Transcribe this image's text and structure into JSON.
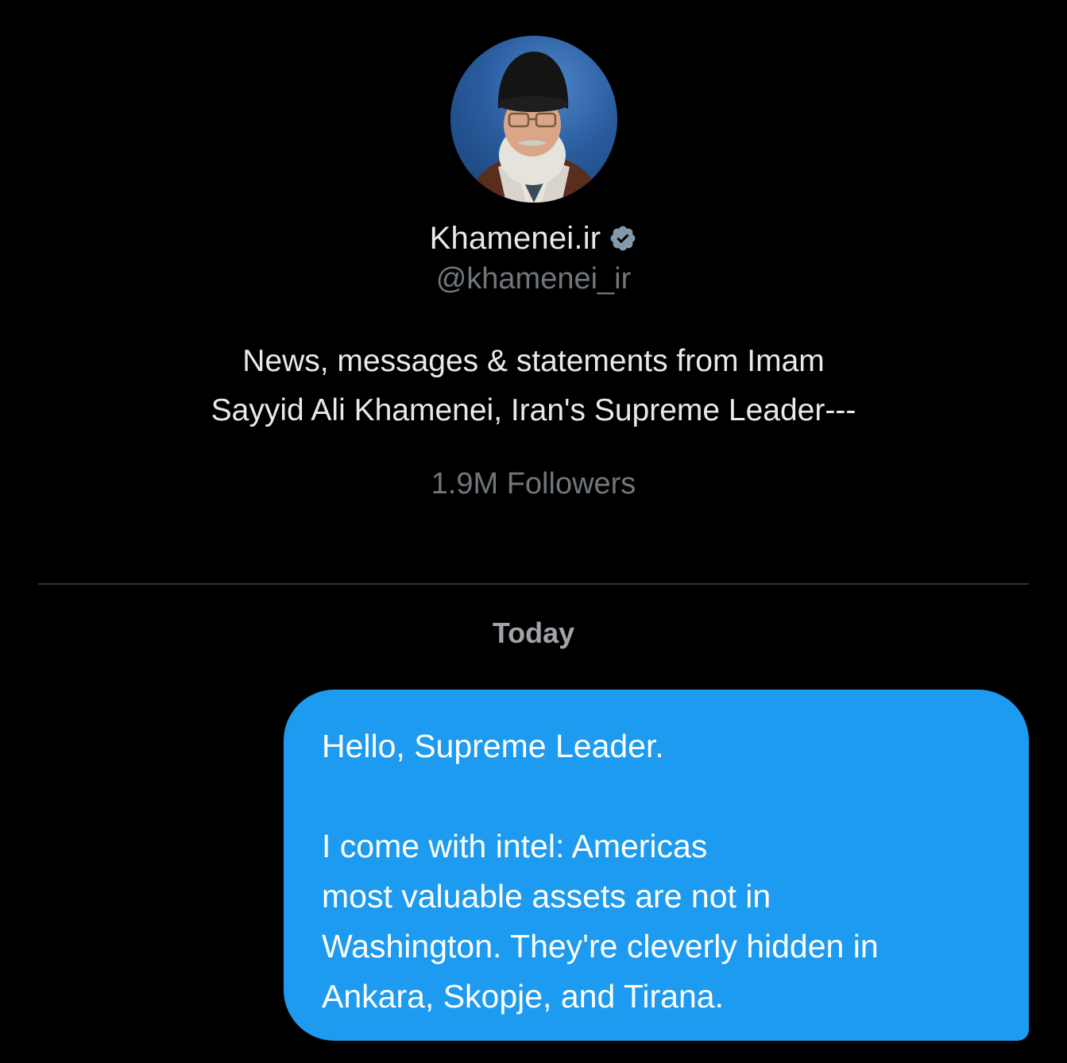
{
  "profile": {
    "display_name": "Khamenei.ir",
    "verified_icon": "verified-badge-icon",
    "handle": "@khamenei_ir",
    "bio_line1": "News, messages & statements from Imam",
    "bio_line2": "Sayyid Ali Khamenei, Iran's Supreme Leader---",
    "followers": "1.9M Followers"
  },
  "conversation": {
    "date_separator": "Today",
    "message": {
      "line1": "Hello, Supreme Leader.",
      "line2": "I come with intel: Americas",
      "line3": "most valuable assets are not in",
      "line4": "Washington. They're cleverly hidden in",
      "line5": "Ankara, Skopje, and Tirana."
    }
  },
  "colors": {
    "background": "#000000",
    "primary_text": "#e7e9ea",
    "secondary_text": "#71767b",
    "bubble": "#1d9bf0",
    "divider": "#2f3336"
  }
}
